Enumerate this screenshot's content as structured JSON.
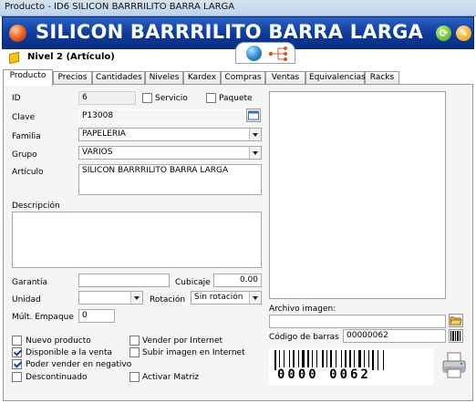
{
  "window": {
    "title": "Producto - ID6 SILICON BARRRILITO BARRA LARGA"
  },
  "banner": {
    "title": "SILICON BARRRILITO BARRA LARGA"
  },
  "level": {
    "label": "Nivel 2 (Artículo)"
  },
  "tabs": [
    "Producto",
    "Precios",
    "Cantidades",
    "Niveles",
    "Kardex",
    "Compras",
    "Ventas",
    "Equivalencias",
    "Racks"
  ],
  "form": {
    "id_label": "ID",
    "id_value": "6",
    "servicio_label": "Servicio",
    "servicio_checked": false,
    "paquete_label": "Paquete",
    "paquete_checked": false,
    "clave_label": "Clave",
    "clave_value": "P13008",
    "familia_label": "Familia",
    "familia_value": "PAPELERIA",
    "grupo_label": "Grupo",
    "grupo_value": "VARIOS",
    "articulo_label": "Artículo",
    "articulo_value": "SILICON BARRRILITO BARRA LARGA",
    "descripcion_label": "Descripción",
    "descripcion_value": "",
    "garantia_label": "Garantía",
    "garantia_value": "",
    "cubicaje_label": "Cubicaje",
    "cubicaje_value": "0.00",
    "unidad_label": "Unidad",
    "unidad_value": "",
    "rotacion_label": "Rotación",
    "rotacion_value": "Sin rotación",
    "mult_label": "Múlt. Empaque",
    "mult_value": "0"
  },
  "checkboxes": [
    {
      "label": "Nuevo producto",
      "checked": false
    },
    {
      "label": "Disponible a la venta",
      "checked": true
    },
    {
      "label": "Poder vender en negativo",
      "checked": true
    },
    {
      "label": "Descontinuado",
      "checked": false
    },
    {
      "label": "Vender por Internet",
      "checked": false
    },
    {
      "label": "Subir imagen en Internet",
      "checked": false
    },
    {
      "label": "Activar Matriz",
      "checked": false
    }
  ],
  "image": {
    "archivo_label": "Archivo imagen:",
    "archivo_value": ""
  },
  "barcode": {
    "label": "Código de barras",
    "value": "00000062",
    "printed": "0000 0062"
  },
  "icons": {
    "banner": "orange-sphere-icon",
    "refresh": "green-refresh-icon",
    "edit": "orange-edit-icon",
    "level": "cube-icon",
    "globe": "globe-icon",
    "tree": "tree-structure-icon",
    "folder": "folder-open-icon",
    "barcode_small": "barcode-icon",
    "printer": "printer-icon",
    "calendar": "calendar-icon"
  }
}
